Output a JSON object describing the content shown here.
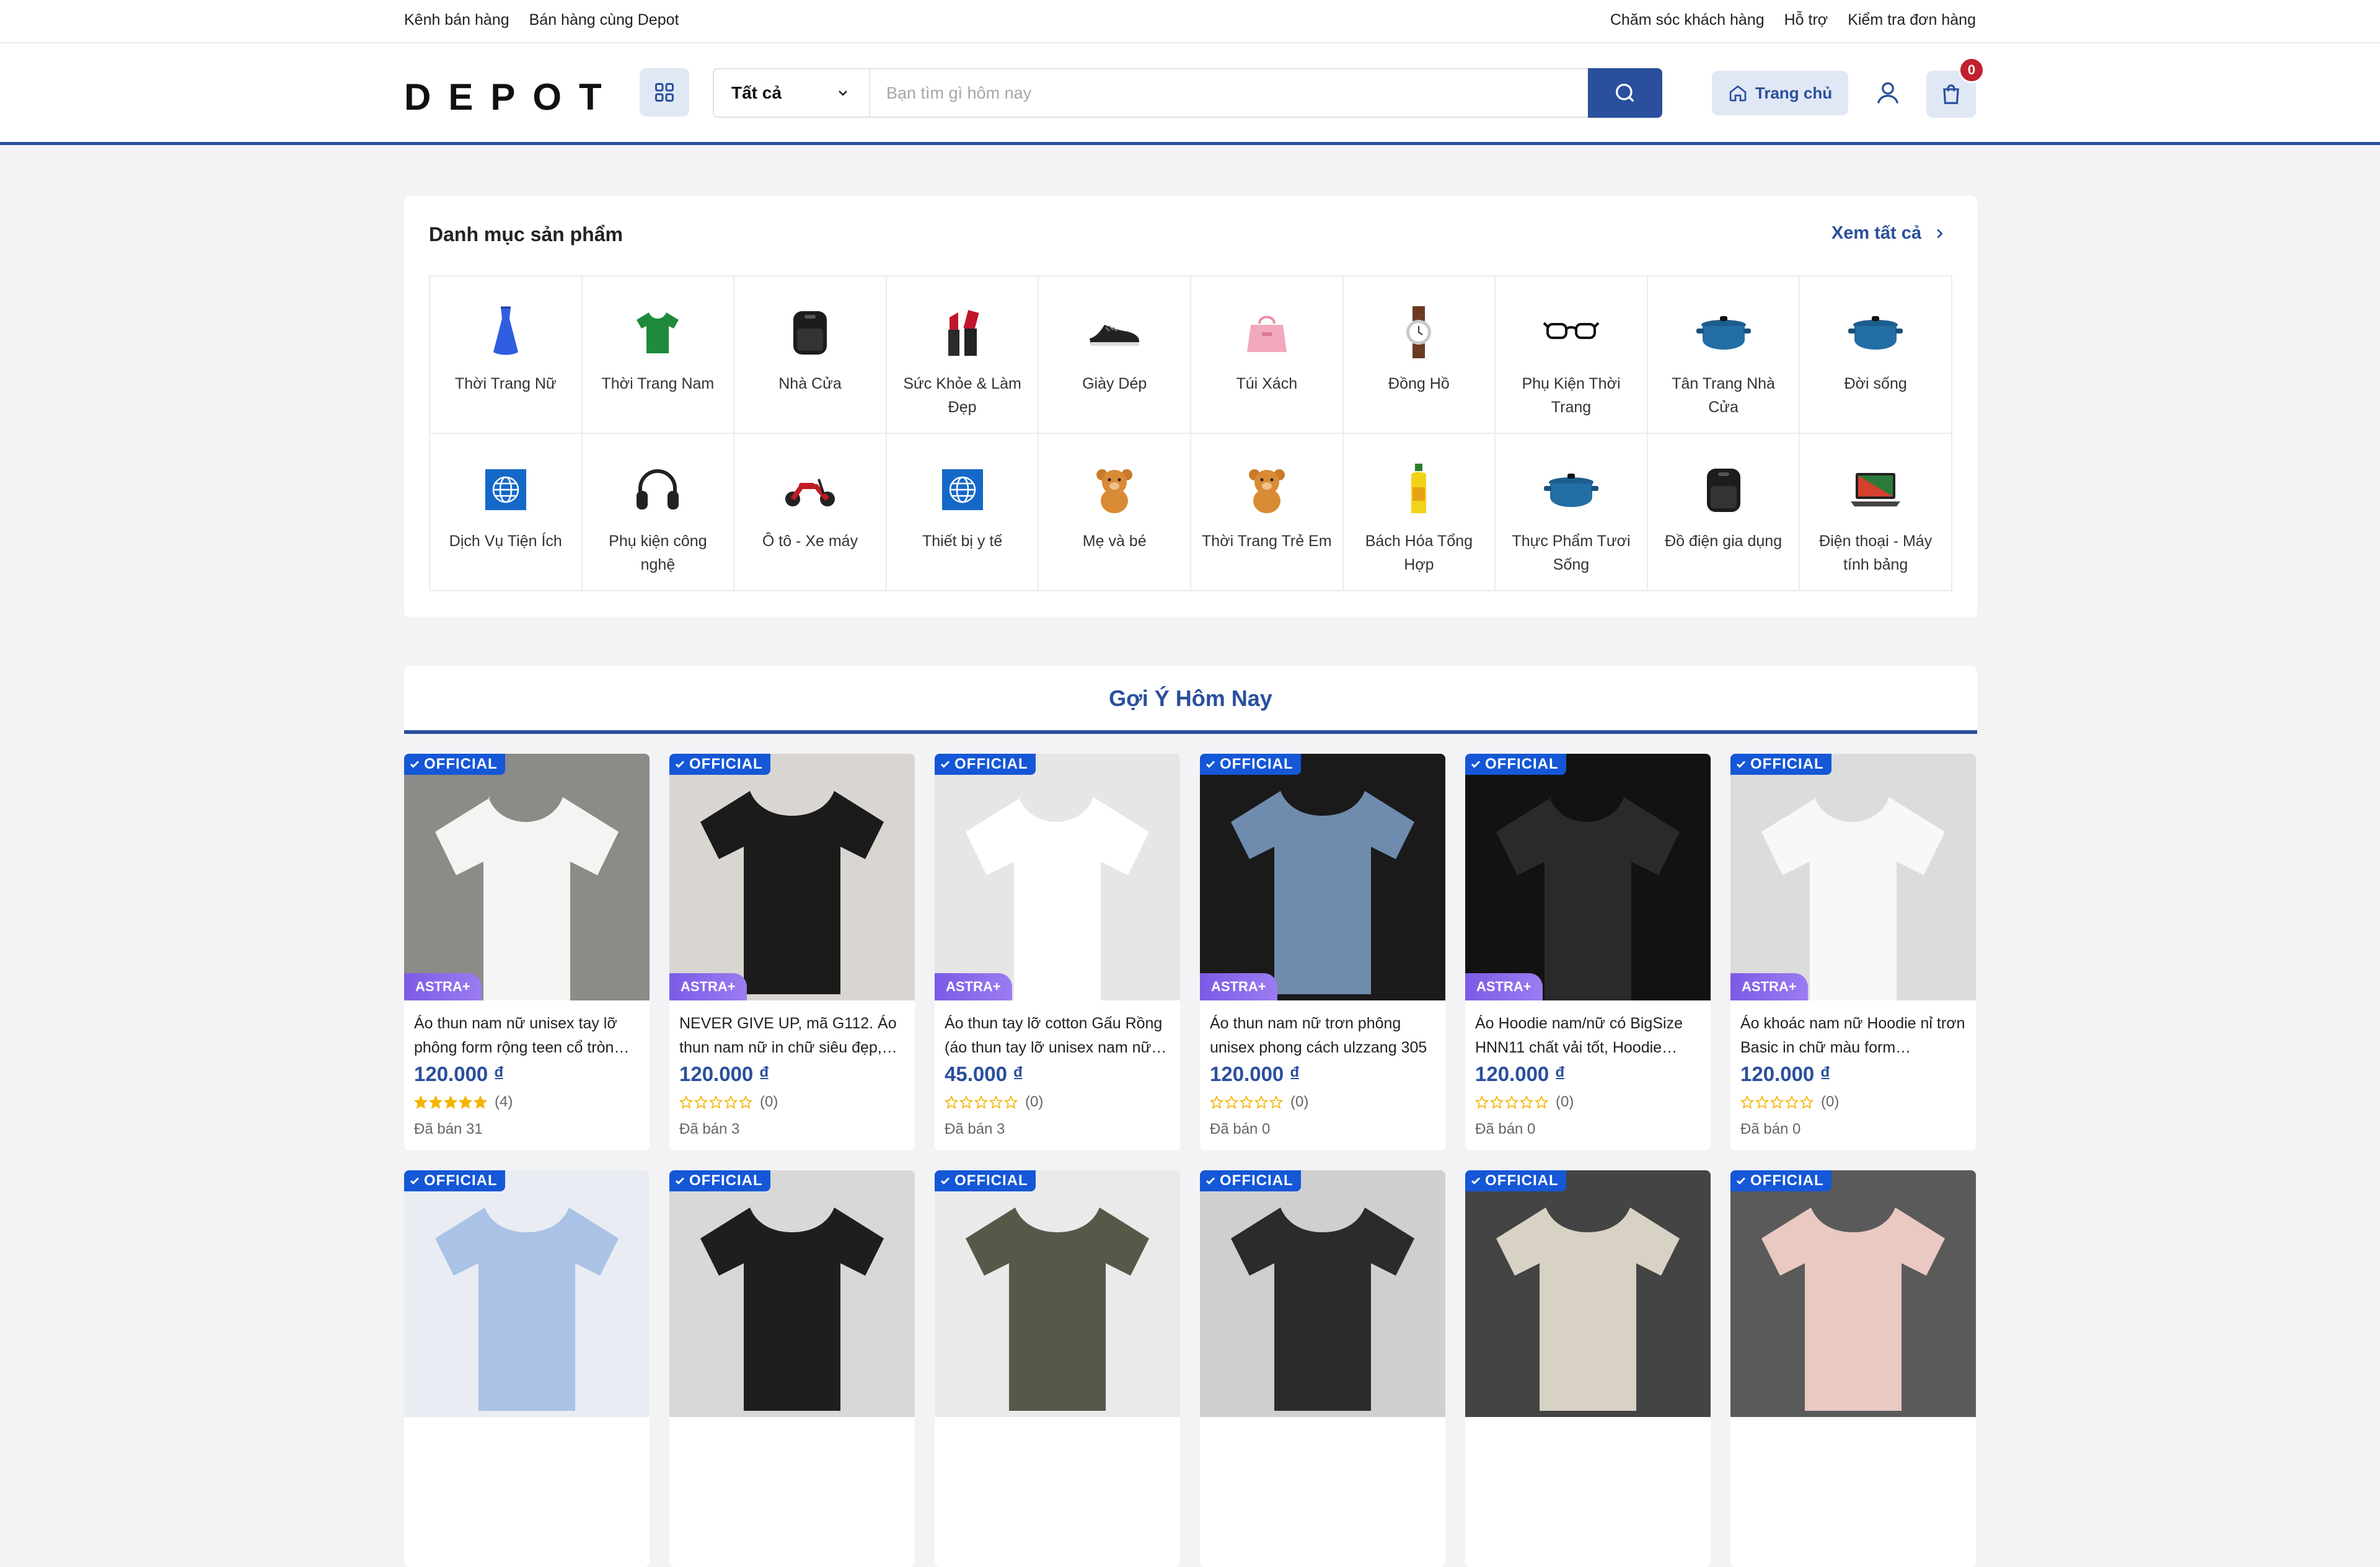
{
  "topbar": {
    "left": [
      "Kênh bán hàng",
      "Bán hàng cùng Depot"
    ],
    "right": [
      "Chăm sóc khách hàng",
      "Hỗ trợ",
      "Kiểm tra đơn hàng"
    ]
  },
  "header": {
    "logo": "DEPOT",
    "search": {
      "category": "Tất cả",
      "placeholder": "Bạn tìm gì hôm nay"
    },
    "home_label": "Trang chủ",
    "cart_count": "0",
    "accent": "#2a4f9c"
  },
  "categories": {
    "title": "Danh mục sản phẩm",
    "view_all": "Xem tất cả",
    "items": [
      {
        "label": "Thời Trang Nữ",
        "icon": "dress-icon"
      },
      {
        "label": "Thời Trang Nam",
        "icon": "tshirt-icon"
      },
      {
        "label": "Nhà Cửa",
        "icon": "air-fryer-icon"
      },
      {
        "label": "Sức Khỏe & Làm Đẹp",
        "icon": "lipstick-icon"
      },
      {
        "label": "Giày Dép",
        "icon": "sneaker-icon"
      },
      {
        "label": "Túi Xách",
        "icon": "handbag-icon"
      },
      {
        "label": "Đồng Hồ",
        "icon": "watch-icon"
      },
      {
        "label": "Phụ Kiện Thời Trang",
        "icon": "glasses-icon"
      },
      {
        "label": "Tân Trang Nhà Cửa",
        "icon": "pot-icon"
      },
      {
        "label": "Đời sống",
        "icon": "pot-icon"
      },
      {
        "label": "Dịch Vụ Tiện Ích",
        "icon": "globe-icon"
      },
      {
        "label": "Phụ kiện công nghệ",
        "icon": "headphones-icon"
      },
      {
        "label": "Ô tô - Xe máy",
        "icon": "scooter-icon"
      },
      {
        "label": "Thiết bị y tế",
        "icon": "globe-icon"
      },
      {
        "label": "Mẹ và bé",
        "icon": "teddy-bear-icon"
      },
      {
        "label": "Thời Trang Trẻ Em",
        "icon": "teddy-bear-icon"
      },
      {
        "label": "Bách Hóa Tổng Hợp",
        "icon": "bottle-icon"
      },
      {
        "label": "Thực Phẩm Tươi Sống",
        "icon": "pot-icon"
      },
      {
        "label": "Đồ điện gia dụng",
        "icon": "air-fryer-icon"
      },
      {
        "label": "Điện thoại - Máy tính bảng",
        "icon": "laptop-icon"
      }
    ]
  },
  "suggestions": {
    "title": "Gợi Ý Hôm Nay",
    "official_label": "OFFICIAL",
    "astra_label": "ASTRA+",
    "products": [
      {
        "name": "Áo thun nam nữ unisex tay lỡ phông form rộng teen cổ tròn…",
        "price": "120.000 ₫",
        "stars": 5,
        "reviews": "(4)",
        "sold": "Đã bán 31",
        "img_bg": "#8b8b88",
        "img_fg": "#f4f4f2"
      },
      {
        "name": "NEVER GIVE UP, mã G112. Áo thun nam nữ in chữ siêu đẹp,…",
        "price": "120.000 ₫",
        "stars": 0,
        "reviews": "(0)",
        "sold": "Đã bán 3",
        "img_bg": "#d9d6d2",
        "img_fg": "#1b1b1b"
      },
      {
        "name": "Áo thun tay lỡ cotton Gấu Rồng (áo thun tay lỡ unisex nam nữ…",
        "price": "45.000 ₫",
        "stars": 0,
        "reviews": "(0)",
        "sold": "Đã bán 3",
        "img_bg": "#e6e6e4",
        "img_fg": "#ffffff"
      },
      {
        "name": "Áo thun nam nữ trơn phông unisex phong cách ulzzang 305",
        "price": "120.000 ₫",
        "stars": 0,
        "reviews": "(0)",
        "sold": "Đã bán 0",
        "img_bg": "#1a1a1a",
        "img_fg": "#6f8cae"
      },
      {
        "name": "Áo Hoodie nam/nữ có BigSize HNN11 chất vải tốt, Hoodie…",
        "price": "120.000 ₫",
        "stars": 0,
        "reviews": "(0)",
        "sold": "Đã bán 0",
        "img_bg": "#121212",
        "img_fg": "#2a2a2a"
      },
      {
        "name": "Áo khoác nam nữ Hoodie nỉ trơn Basic in chữ màu form…",
        "price": "120.000 ₫",
        "stars": 0,
        "reviews": "(0)",
        "sold": "Đã bán 0",
        "img_bg": "#dcdcdc",
        "img_fg": "#f8f8f8"
      },
      {
        "img_bg": "#e9ecf2",
        "img_fg": "#a9c2e6"
      },
      {
        "img_bg": "#d8d8d8",
        "img_fg": "#1e1e1e"
      },
      {
        "img_bg": "#eaeaea",
        "img_fg": "#555a48"
      },
      {
        "img_bg": "#cfcfcf",
        "img_fg": "#2b2b2b"
      },
      {
        "img_bg": "#444444",
        "img_fg": "#d8d2c4"
      },
      {
        "img_bg": "#5a5a5a",
        "img_fg": "#e9c9c2"
      }
    ]
  }
}
